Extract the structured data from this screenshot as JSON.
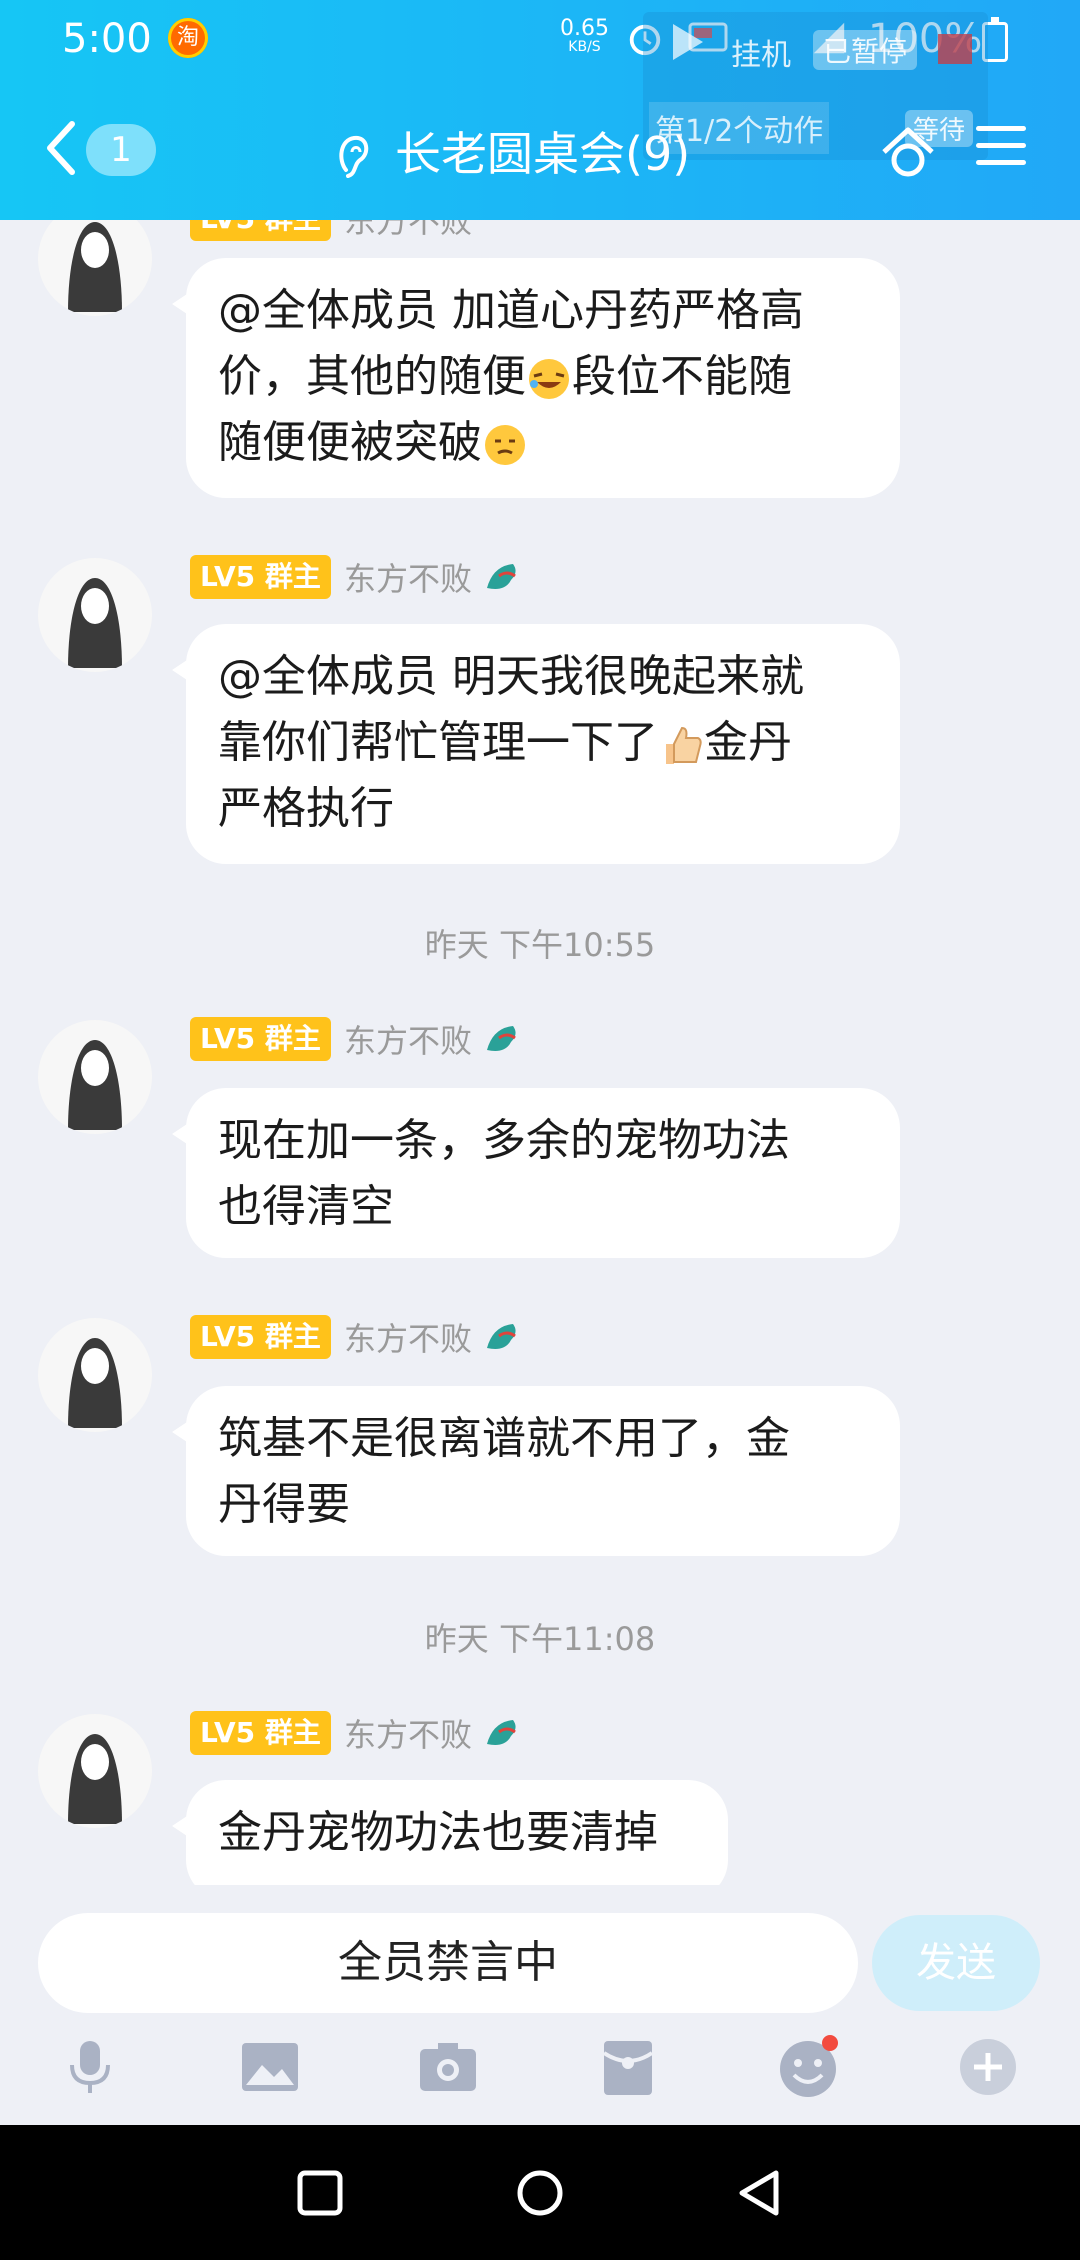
{
  "status_bar": {
    "time": "5:00",
    "taobao_label": "淘",
    "net_speed_value": "0.65",
    "net_speed_unit": "KB/S",
    "battery": "100%"
  },
  "overlay": {
    "title": "挂机",
    "paused": "已暂停",
    "step": "第1/2个动作",
    "wait": "等待"
  },
  "header": {
    "unread_count": "1",
    "title": "长老圆桌会(9)"
  },
  "sender": {
    "level": "LV5 群主",
    "name": "东方不败"
  },
  "messages": [
    {
      "lines": [
        "@全体成员 加道心丹药严格高",
        "价，其他的随便",
        "段位不能随",
        "随便便被突破"
      ]
    },
    {
      "lines": [
        "@全体成员 明天我很晚起来就",
        "靠你们帮忙管理一下了",
        "金丹",
        "严格执行"
      ]
    },
    {
      "lines": [
        "现在加一条，多余的宠物功法",
        "也得清空"
      ]
    },
    {
      "lines": [
        "筑基不是很离谱就不用了，金",
        "丹得要"
      ]
    },
    {
      "lines": [
        "金丹宠物功法也要清掉"
      ]
    }
  ],
  "timestamps": [
    "昨天 下午10:55",
    "昨天 下午11:08"
  ],
  "input": {
    "muted_text": "全员禁言中",
    "send_label": "发送"
  },
  "colors": {
    "header_start": "#16c6f5",
    "header_end": "#21a8f7",
    "level_badge": "#ffc21a",
    "notification_dot": "#f24b3f"
  }
}
